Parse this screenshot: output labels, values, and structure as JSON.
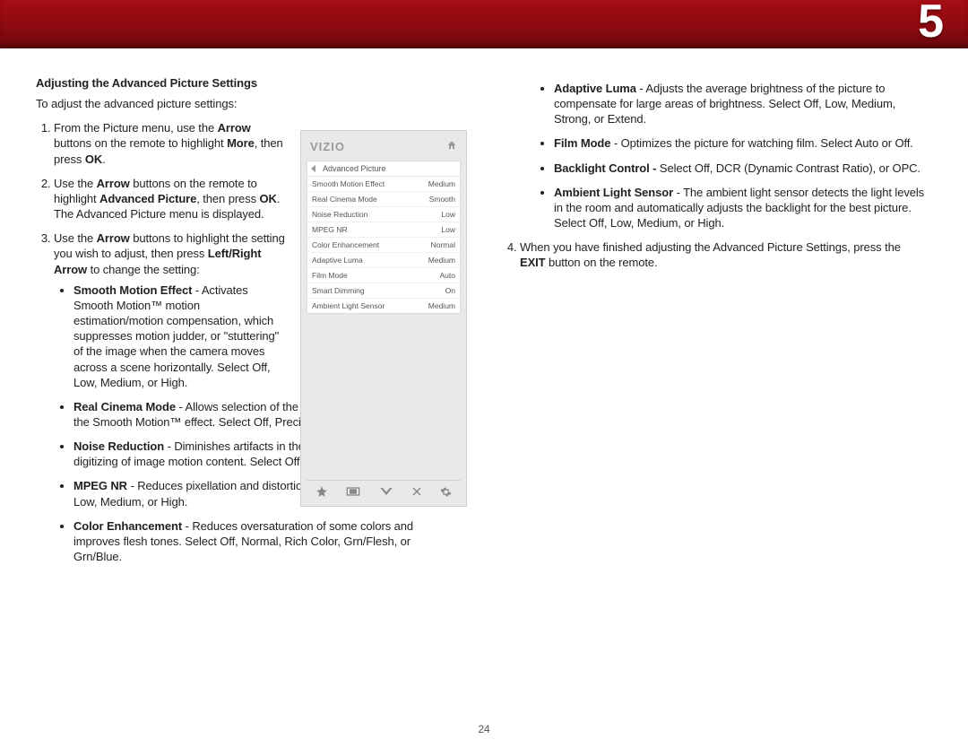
{
  "chapter": "5",
  "page_number": "24",
  "left": {
    "heading": "Adjusting the Advanced Picture Settings",
    "intro": "To adjust the advanced picture settings:",
    "step1_a": "From the Picture menu, use the ",
    "step1_b": "Arrow",
    "step1_c": " buttons on the remote to highlight ",
    "step1_d": "More",
    "step1_e": ", then press ",
    "step1_f": "OK",
    "step1_g": ".",
    "step2_a": "Use the ",
    "step2_b": "Arrow",
    "step2_c": " buttons on the remote to highlight ",
    "step2_d": "Advanced Picture",
    "step2_e": ", then press ",
    "step2_f": "OK",
    "step2_g": ". The Advanced Picture menu is displayed.",
    "step3_a": "Use the ",
    "step3_b": "Arrow",
    "step3_c": " buttons to highlight the setting you wish to adjust, then press ",
    "step3_d": "Left/Right Arrow",
    "step3_e": " to change the setting:",
    "b1_t": "Smooth Motion Effect",
    "b1_d": " - Activates Smooth Motion™ motion estimation/motion compensation, which suppresses motion judder, or \"stuttering\" of the image when the camera moves across a scene horizontally. Select Off, Low, Medium, or High.",
    "b2_t": "Real Cinema Mode",
    "b2_d": " - Allows selection of the type of compensation used for the Smooth Motion™ effect. Select Off, Precision or Smooth.",
    "b3_t": "Noise Reduction",
    "b3_d": " - Diminishes artifacts in the image caused by the digitizing of image motion content. Select Off, Low, Medium, or High.",
    "b4_t": "MPEG NR",
    "b4_d": " - Reduces pixellation and distortion for .mpeg files. Select Off, Low, Medium, or High.",
    "b5_t": "Color Enhancement",
    "b5_d": " - Reduces oversaturation of some colors and improves flesh tones. Select Off, Normal, Rich Color, Grn/Flesh, or Grn/Blue."
  },
  "right": {
    "b6_t": "Adaptive Luma",
    "b6_d": " - Adjusts the average brightness of the picture to compensate for large areas of brightness. Select Off, Low, Medium, Strong, or Extend.",
    "b7_t": "Film Mode",
    "b7_d": " - Optimizes the picture for watching film. Select Auto or Off.",
    "b8_t": "Backlight Control - ",
    "b8_d": "Select Off, DCR (Dynamic Contrast Ratio), or OPC.",
    "b9_t": "Ambient Light Sensor",
    "b9_d": " - The ambient light sensor detects the light levels in the room and automatically adjusts the backlight for the best picture. Select Off, Low, Medium, or High.",
    "step4_a": "When you have finished adjusting the Advanced Picture Settings, press the ",
    "step4_b": "EXIT",
    "step4_c": " button on the remote."
  },
  "menu": {
    "brand": "VIZIO",
    "title": "Advanced Picture",
    "rows": [
      {
        "label": "Smooth Motion Effect",
        "value": "Medium"
      },
      {
        "label": "Real Cinema Mode",
        "value": "Smooth"
      },
      {
        "label": "Noise Reduction",
        "value": "Low"
      },
      {
        "label": "MPEG NR",
        "value": "Low"
      },
      {
        "label": "Color Enhancement",
        "value": "Normal"
      },
      {
        "label": "Adaptive Luma",
        "value": "Medium"
      },
      {
        "label": "Film Mode",
        "value": "Auto"
      },
      {
        "label": "Smart Dimming",
        "value": "On"
      },
      {
        "label": "Ambient Light Sensor",
        "value": "Medium"
      }
    ]
  }
}
